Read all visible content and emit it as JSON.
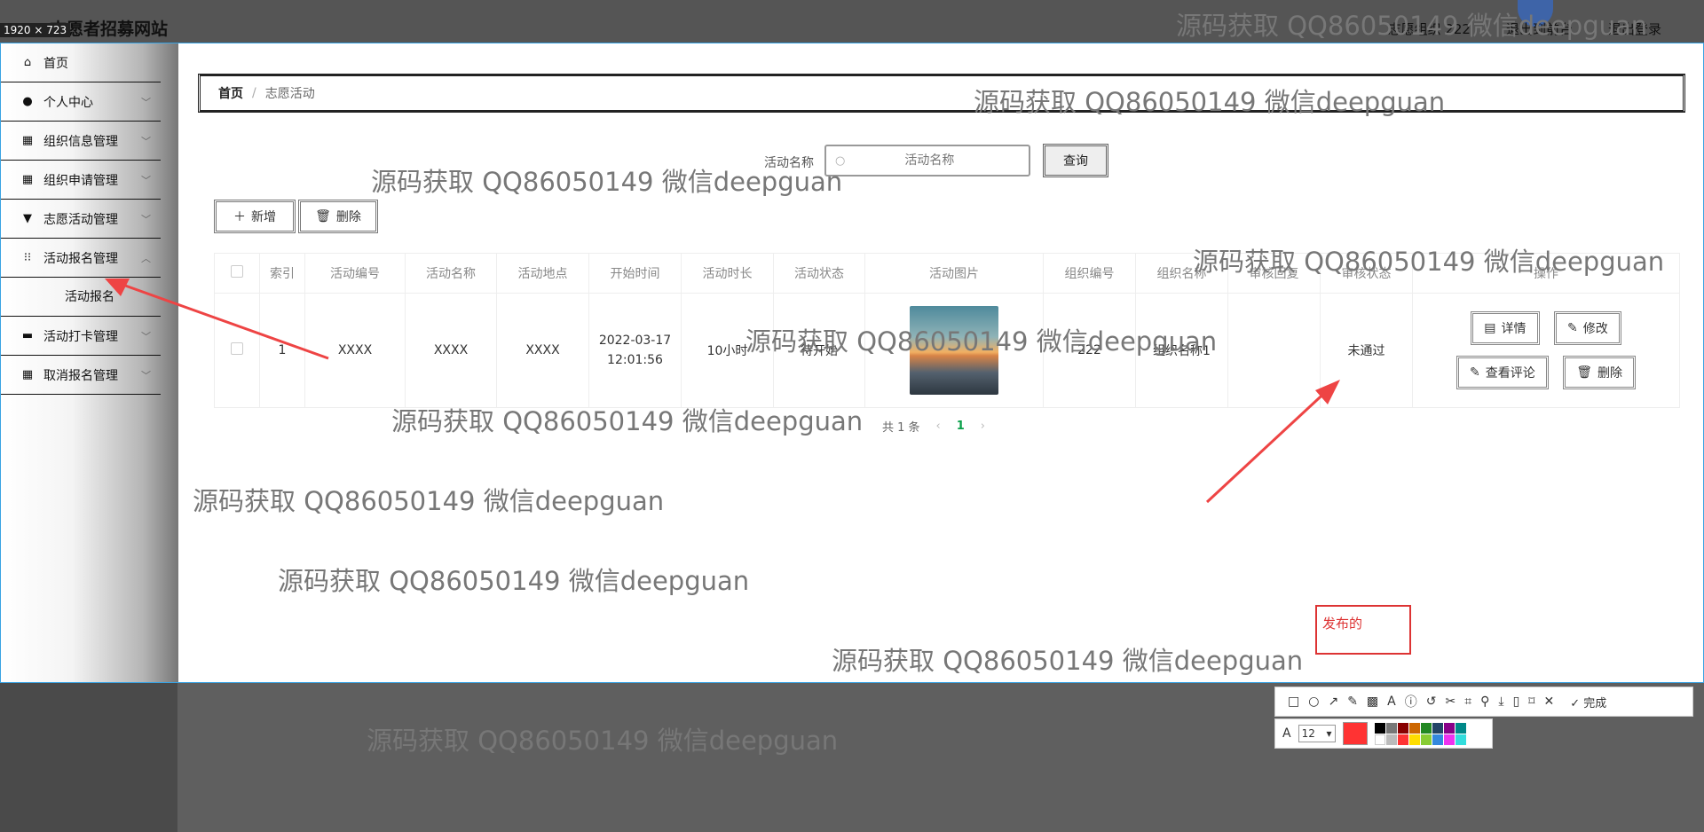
{
  "screen": {
    "site_title": "志愿者招募网站",
    "size_badge": "1920 × 723",
    "top_right": [
      "志愿组织 222",
      "退出到前台",
      "退出登录"
    ]
  },
  "sidebar": {
    "items": [
      {
        "label": "首页",
        "icon": "home-icon"
      },
      {
        "label": "个人中心",
        "icon": "user-icon"
      },
      {
        "label": "组织信息管理",
        "icon": "grid-icon"
      },
      {
        "label": "组织申请管理",
        "icon": "grid-icon"
      },
      {
        "label": "志愿活动管理",
        "icon": "brush-icon"
      },
      {
        "label": "活动报名管理",
        "icon": "apps-icon"
      },
      {
        "label": "活动打卡管理",
        "icon": "briefcase-icon"
      },
      {
        "label": "取消报名管理",
        "icon": "grid-icon"
      }
    ],
    "submenu": "活动报名"
  },
  "breadcrumb": {
    "home": "首页",
    "sep": "/",
    "current": "志愿活动"
  },
  "search": {
    "label": "活动名称",
    "placeholder": "活动名称",
    "button": "查询"
  },
  "actions": {
    "add": "新增",
    "delete": "删除"
  },
  "table": {
    "headers": [
      "索引",
      "活动编号",
      "活动名称",
      "活动地点",
      "开始时间",
      "活动时长",
      "活动状态",
      "活动图片",
      "组织编号",
      "组织名称",
      "审核回复",
      "审核状态",
      "操作"
    ],
    "row": {
      "index": "1",
      "code": "XXXX",
      "name": "XXXX",
      "location": "XXXX",
      "start_date": "2022-03-17",
      "start_time": "12:01:56",
      "duration": "10小时",
      "status": "待开始",
      "org_code": "222",
      "org_name": "组织名称1",
      "reply": "",
      "audit": "未通过"
    },
    "ops": {
      "detail": "详情",
      "edit": "修改",
      "comments": "查看评论",
      "delete": "删除"
    }
  },
  "pager": {
    "total": "共 1 条",
    "prev": "‹",
    "page": "1",
    "next": "›"
  },
  "watermark": "源码获取 QQ86050149 微信deepguan",
  "annotation": {
    "text": "发布的"
  },
  "snip_toolbar": {
    "done": "完成",
    "font_size": "12"
  },
  "colors": {
    "accent": "#0aa04a",
    "annotation": "#dd3333",
    "border": "#39a3e3"
  }
}
